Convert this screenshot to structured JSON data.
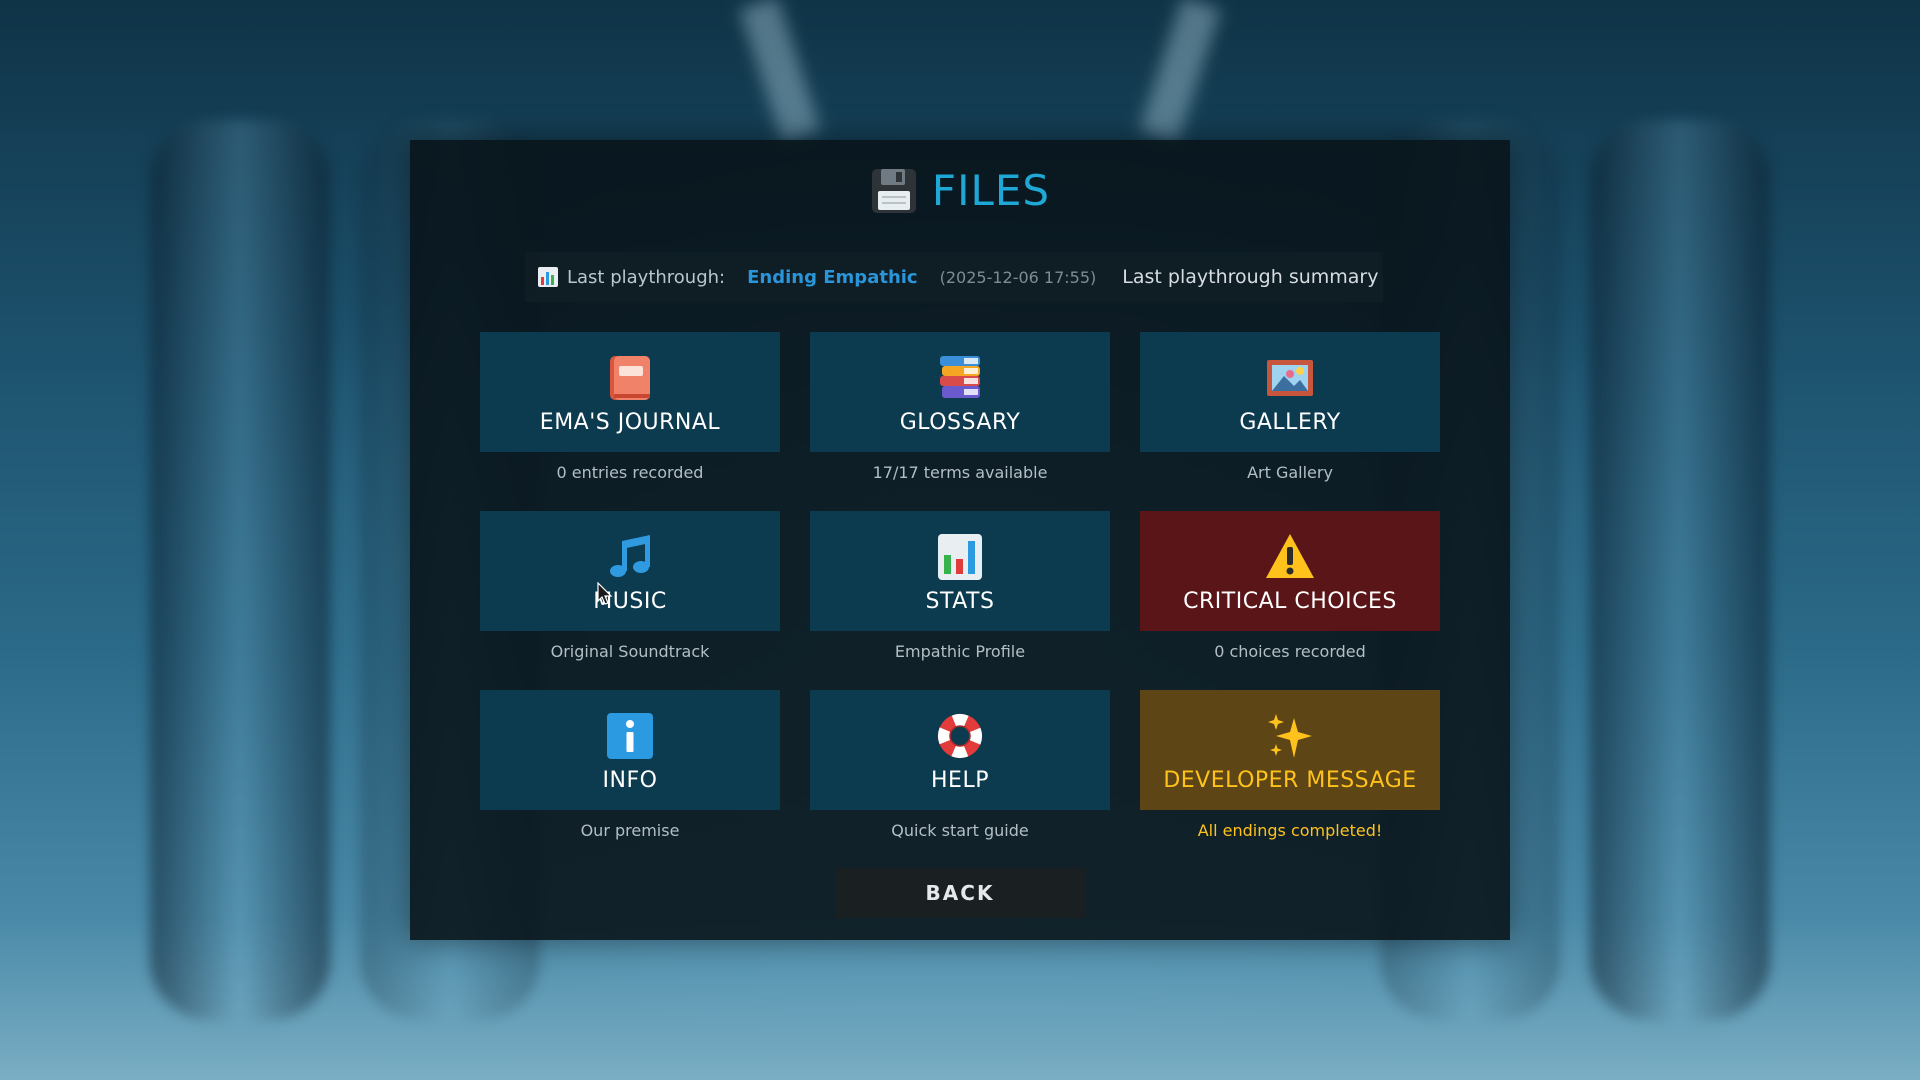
{
  "header": {
    "title": "FILES",
    "title_icon": "floppy-disk-icon"
  },
  "summary": {
    "icon": "bar-chart-icon",
    "label": "Last playthrough:",
    "ending": "Ending Empathic",
    "date": "(2025-12-06 17:55)",
    "link": "Last playthrough summary"
  },
  "tiles": [
    {
      "label": "EMA'S JOURNAL",
      "subtitle": "0 entries recorded",
      "icon": "journal-book-icon"
    },
    {
      "label": "GLOSSARY",
      "subtitle": "17/17 terms available",
      "icon": "books-stack-icon"
    },
    {
      "label": "GALLERY",
      "subtitle": "Art Gallery",
      "icon": "picture-frame-icon"
    },
    {
      "label": "MUSIC",
      "subtitle": "Original Soundtrack",
      "icon": "music-note-icon"
    },
    {
      "label": "STATS",
      "subtitle": "Empathic Profile",
      "icon": "bar-chart-icon"
    },
    {
      "label": "CRITICAL CHOICES",
      "subtitle": "0 choices recorded",
      "icon": "warning-icon"
    },
    {
      "label": "INFO",
      "subtitle": "Our premise",
      "icon": "info-icon"
    },
    {
      "label": "HELP",
      "subtitle": "Quick start guide",
      "icon": "lifebuoy-icon"
    },
    {
      "label": "DEVELOPER MESSAGE",
      "subtitle": "All endings completed!",
      "icon": "sparkles-icon"
    }
  ],
  "back_label": "BACK",
  "colors": {
    "accent": "#1fa7d6",
    "tile": "#0c3a4e",
    "critical": "#5a1519",
    "developer": "#5d4516",
    "gold": "#ffc21c"
  }
}
